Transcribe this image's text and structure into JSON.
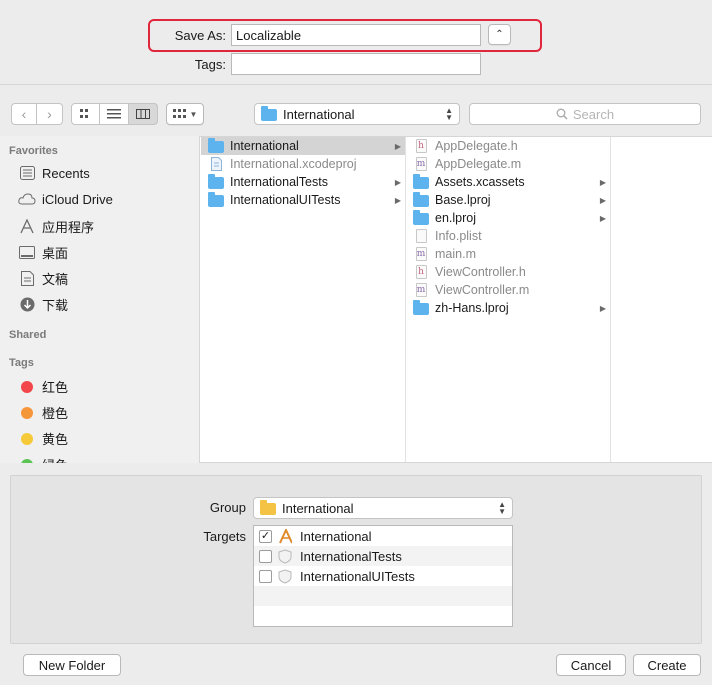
{
  "save_as": {
    "label": "Save As:",
    "value": "Localizable"
  },
  "tags": {
    "label": "Tags:",
    "value": ""
  },
  "toolbar": {
    "location": "International",
    "search_placeholder": "Search"
  },
  "sidebar": {
    "favorites_header": "Favorites",
    "favorites": [
      {
        "label": "Recents",
        "icon": "clock-icon"
      },
      {
        "label": "iCloud Drive",
        "icon": "cloud-icon"
      },
      {
        "label": "应用程序",
        "icon": "applications-icon"
      },
      {
        "label": "桌面",
        "icon": "desktop-icon"
      },
      {
        "label": "文稿",
        "icon": "documents-icon"
      },
      {
        "label": "下载",
        "icon": "downloads-icon"
      }
    ],
    "shared_header": "Shared",
    "tags_header": "Tags",
    "tags": [
      {
        "label": "红色",
        "color": "#f2464b"
      },
      {
        "label": "橙色",
        "color": "#f6963a"
      },
      {
        "label": "黄色",
        "color": "#f6c938"
      },
      {
        "label": "绿色",
        "color": "#5cc453"
      }
    ]
  },
  "column1": [
    {
      "name": "International",
      "kind": "folder",
      "selected": true,
      "arrow": true
    },
    {
      "name": "International.xcodeproj",
      "kind": "file",
      "dim": true
    },
    {
      "name": "InternationalTests",
      "kind": "folder",
      "arrow": true
    },
    {
      "name": "InternationalUITests",
      "kind": "folder",
      "arrow": true
    }
  ],
  "column2": [
    {
      "name": "AppDelegate.h",
      "kind": "h",
      "dim": true
    },
    {
      "name": "AppDelegate.m",
      "kind": "m",
      "dim": true
    },
    {
      "name": "Assets.xcassets",
      "kind": "folder",
      "arrow": true
    },
    {
      "name": "Base.lproj",
      "kind": "folder",
      "arrow": true
    },
    {
      "name": "en.lproj",
      "kind": "folder",
      "arrow": true
    },
    {
      "name": "Info.plist",
      "kind": "plist",
      "dim": true
    },
    {
      "name": "main.m",
      "kind": "m",
      "dim": true
    },
    {
      "name": "ViewController.h",
      "kind": "h",
      "dim": true
    },
    {
      "name": "ViewController.m",
      "kind": "m",
      "dim": true
    },
    {
      "name": "zh-Hans.lproj",
      "kind": "folder",
      "arrow": true
    }
  ],
  "options": {
    "group_label": "Group",
    "group_value": "International",
    "targets_label": "Targets",
    "targets": [
      {
        "name": "International",
        "checked": true
      },
      {
        "name": "InternationalTests",
        "checked": false
      },
      {
        "name": "InternationalUITests",
        "checked": false
      }
    ]
  },
  "buttons": {
    "new_folder": "New Folder",
    "cancel": "Cancel",
    "create": "Create"
  }
}
